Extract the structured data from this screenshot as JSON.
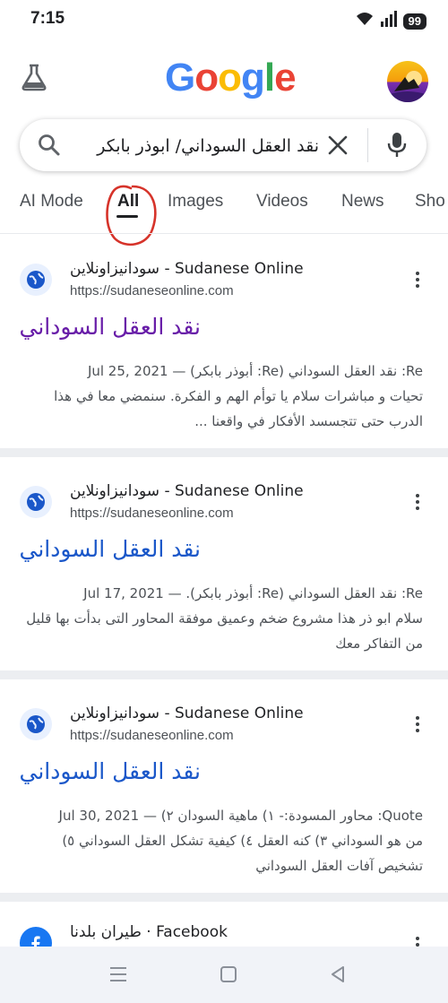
{
  "status_bar": {
    "time": "7:15",
    "battery": "99"
  },
  "header": {
    "logo_letters": [
      "G",
      "o",
      "o",
      "g",
      "l",
      "e"
    ],
    "logo_colors": [
      "#4285F4",
      "#EA4335",
      "#FBBC05",
      "#4285F4",
      "#34A853",
      "#EA4335"
    ]
  },
  "search": {
    "query": "نقد العقل السوداني/ ابوذر بابكر"
  },
  "tabs": [
    {
      "label": "AI Mode"
    },
    {
      "label": "All",
      "active": true
    },
    {
      "label": "Images"
    },
    {
      "label": "Videos"
    },
    {
      "label": "News"
    },
    {
      "label": "Sho"
    }
  ],
  "results": [
    {
      "site": "سودانيزاونلاين - Sudanese Online",
      "url": "https://sudaneseonline.com",
      "title": "نقد العقل السوداني",
      "snippet_head": "Re: نقد العقل السوداني (Re: أبوذر بابكر) — Jul 25, 2021",
      "snippet_rest": "تحيات و مباشرات سلام يا توأم الهم و الفكرة. سنمضي معا في هذا الدرب حتى تتجسسد الأفكار في واقعنا ..."
    },
    {
      "site": "سودانيزاونلاين - Sudanese Online",
      "url": "https://sudaneseonline.com",
      "title": "نقد العقل السوداني",
      "snippet_head": "Re: نقد العقل السوداني (Re: أبوذر بابكر). — Jul 17, 2021",
      "snippet_rest": "سلام ابو ذر هذا مشروع ضخم وعميق موفقة المحاور التى بدأت بها قليل من التفاكر معك"
    },
    {
      "site": "سودانيزاونلاين - Sudanese Online",
      "url": "https://sudaneseonline.com",
      "title": "نقد العقل السوداني",
      "snippet_head": "Quote: محاور المسودة:- ١) ماهية السودان ٢) — Jul 30, 2021",
      "snippet_rest": "من هو السوداني ٣) كنه العقل ٤) كيفية تشكل العقل السوداني ٥) تشخيص آفات العقل السوداني"
    },
    {
      "site": "طيران بلدنا · Facebook"
    }
  ]
}
